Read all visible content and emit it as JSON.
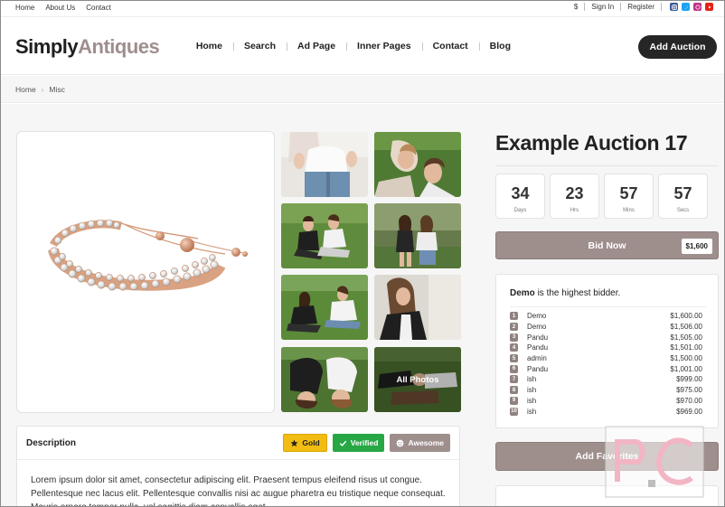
{
  "topbar": {
    "links": [
      "Home",
      "About Us",
      "Contact"
    ],
    "currency": "$",
    "sign_in": "Sign In",
    "register": "Register",
    "social": [
      {
        "icon": "instagram-icon",
        "color": "#3b5998"
      },
      {
        "icon": "twitter-icon",
        "color": "#1da1f2"
      },
      {
        "icon": "dribbble-icon",
        "color": "#c13584"
      },
      {
        "icon": "youtube-icon",
        "color": "#e62117"
      }
    ]
  },
  "header": {
    "logo_part1": "Simply",
    "logo_part2": "Antiques",
    "nav": [
      "Home",
      "Search",
      "Ad Page",
      "Inner Pages",
      "Contact",
      "Blog"
    ],
    "cta": "Add Auction"
  },
  "breadcrumb": {
    "items": [
      "Home",
      "Misc"
    ]
  },
  "gallery": {
    "all_photos_label": "All Photos"
  },
  "description": {
    "title": "Description",
    "badges": [
      {
        "label": "Gold",
        "icon": "star-icon",
        "color": "#f2bd12"
      },
      {
        "label": "Verified",
        "icon": "check-icon",
        "color": "#28a745"
      },
      {
        "label": "Awesome",
        "icon": "smile-icon",
        "color": "#9e8f8d"
      }
    ],
    "text": "Lorem ipsum dolor sit amet, consectetur adipiscing elit. Praesent tempus eleifend risus ut congue. Pellentesque nec lacus elit. Pellentesque convallis nisi ac augue pharetra eu tristique neque consequat. Mauris ornare tempor nulla, vel sagittis diam convallis eget."
  },
  "auction": {
    "title": "Example Auction 17",
    "countdown": [
      {
        "value": "34",
        "label": "Days"
      },
      {
        "value": "23",
        "label": "Hrs"
      },
      {
        "value": "57",
        "label": "Mins"
      },
      {
        "value": "57",
        "label": "Secs"
      }
    ],
    "bid_label": "Bid Now",
    "bid_price": "$1,600",
    "highest_bidder": "Demo",
    "highest_bidder_suffix": " is the highest bidder.",
    "bids": [
      {
        "n": "1",
        "name": "Demo",
        "amount": "$1,600.00"
      },
      {
        "n": "2",
        "name": "Demo",
        "amount": "$1,506.00"
      },
      {
        "n": "3",
        "name": "Pandu",
        "amount": "$1,505.00"
      },
      {
        "n": "4",
        "name": "Pandu",
        "amount": "$1,501.00"
      },
      {
        "n": "5",
        "name": "admin",
        "amount": "$1,500.00"
      },
      {
        "n": "6",
        "name": "Pandu",
        "amount": "$1,001.00"
      },
      {
        "n": "7",
        "name": "ish",
        "amount": "$999.00"
      },
      {
        "n": "8",
        "name": "ish",
        "amount": "$975.00"
      },
      {
        "n": "9",
        "name": "ish",
        "amount": "$970.00"
      },
      {
        "n": "10",
        "name": "ish",
        "amount": "$969.00"
      }
    ],
    "favorites_label": "Add Favorites"
  }
}
